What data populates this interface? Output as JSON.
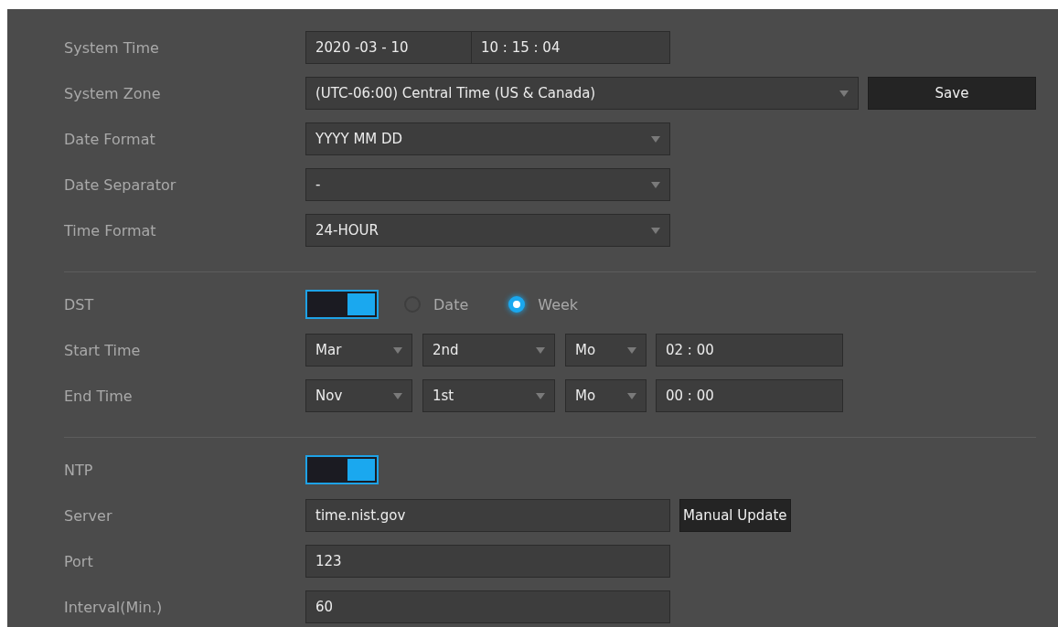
{
  "sections": [
    {
      "rows": [
        {
          "kind": "datetime",
          "label": "System Time",
          "date": "2020  -03 - 10",
          "time": "10 : 15 : 04"
        },
        {
          "kind": "select",
          "label": "System Zone",
          "value": "(UTC-06:00) Central Time (US & Canada)",
          "button": "Save"
        },
        {
          "kind": "select",
          "label": "Date Format",
          "value": "YYYY MM DD"
        },
        {
          "kind": "select",
          "label": "Date Separator",
          "value": "-"
        },
        {
          "kind": "select",
          "label": "Time Format",
          "value": "24-HOUR"
        }
      ]
    },
    {
      "rows": [
        {
          "kind": "toggle",
          "label": "DST",
          "on": true,
          "options": [
            {
              "label": "Date",
              "selected": false
            },
            {
              "label": "Week",
              "selected": true
            }
          ]
        },
        {
          "kind": "schedule",
          "label": "Start Time",
          "month": "Mar",
          "week": "2nd",
          "day": "Mo",
          "time": "02 : 00"
        },
        {
          "kind": "schedule",
          "label": "End Time",
          "month": "Nov",
          "week": "1st",
          "day": "Mo",
          "time": "00 : 00"
        }
      ]
    },
    {
      "rows": [
        {
          "kind": "toggle",
          "label": "NTP",
          "on": true
        },
        {
          "kind": "input",
          "label": "Server",
          "value": "time.nist.gov",
          "button": "Manual Update"
        },
        {
          "kind": "input",
          "label": "Port",
          "value": "123"
        },
        {
          "kind": "input",
          "label": "Interval(Min.)",
          "value": "60"
        }
      ]
    }
  ]
}
